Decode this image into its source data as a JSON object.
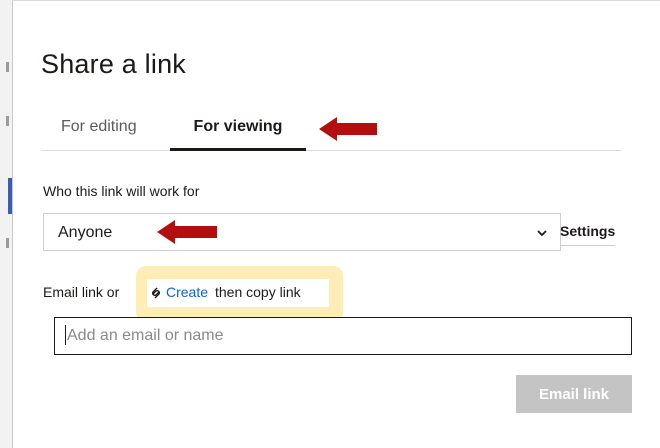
{
  "dialog": {
    "title": "Share a link",
    "tabs": [
      {
        "label": "For editing",
        "active": false
      },
      {
        "label": "For viewing",
        "active": true
      }
    ],
    "who_label": "Who this link will work for",
    "audience": {
      "selected": "Anyone"
    },
    "settings_label": "Settings",
    "email_row": {
      "prefix": "Email link or",
      "create_label": "Create",
      "suffix": "then copy link",
      "link_icon": "link-icon"
    },
    "email_input": {
      "value": "",
      "placeholder": "Add an email or name"
    },
    "email_button_label": "Email link",
    "colors": {
      "accent_link": "#0b62d6",
      "annotation_arrow": "#b30f0f",
      "annotation_highlight": "#ffe8a3",
      "disabled_button": "#c4c4c4"
    }
  }
}
